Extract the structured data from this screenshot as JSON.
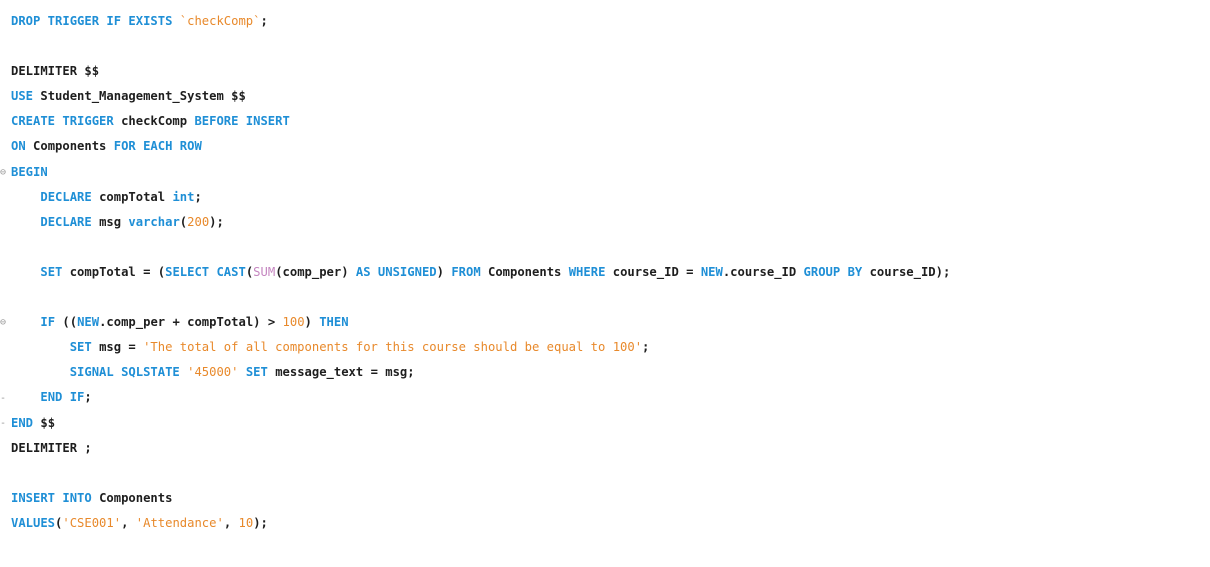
{
  "colors": {
    "keyword": "#1f8fd6",
    "string": "#e8892b",
    "number": "#e8892b",
    "function": "#c586c0",
    "text": "#1e1e1e",
    "background": "#ffffff"
  },
  "gutter_marks": [
    {
      "line_index": 6,
      "glyph": "⊖"
    },
    {
      "line_index": 12,
      "glyph": "⊖"
    },
    {
      "line_index": 15,
      "glyph": "-"
    },
    {
      "line_index": 16,
      "glyph": "-"
    }
  ],
  "lines": [
    [
      {
        "t": "kw",
        "v": "DROP TRIGGER IF EXISTS "
      },
      {
        "t": "str",
        "v": "`checkComp`"
      },
      {
        "t": "plain",
        "v": ";"
      }
    ],
    [],
    [
      {
        "t": "plain",
        "v": "DELIMITER $$"
      }
    ],
    [
      {
        "t": "kw",
        "v": "USE "
      },
      {
        "t": "plain",
        "v": "Student_Management_System $$"
      }
    ],
    [
      {
        "t": "kw",
        "v": "CREATE TRIGGER "
      },
      {
        "t": "plain",
        "v": "checkComp "
      },
      {
        "t": "kw",
        "v": "BEFORE INSERT"
      }
    ],
    [
      {
        "t": "kw",
        "v": "ON "
      },
      {
        "t": "plain",
        "v": "Components "
      },
      {
        "t": "kw",
        "v": "FOR EACH ROW"
      }
    ],
    [
      {
        "t": "kw",
        "v": "BEGIN"
      }
    ],
    [
      {
        "t": "plain",
        "v": "    "
      },
      {
        "t": "kw",
        "v": "DECLARE "
      },
      {
        "t": "plain",
        "v": "compTotal "
      },
      {
        "t": "kw",
        "v": "int"
      },
      {
        "t": "plain",
        "v": ";"
      }
    ],
    [
      {
        "t": "plain",
        "v": "    "
      },
      {
        "t": "kw",
        "v": "DECLARE "
      },
      {
        "t": "plain",
        "v": "msg "
      },
      {
        "t": "kw",
        "v": "varchar"
      },
      {
        "t": "plain",
        "v": "("
      },
      {
        "t": "num",
        "v": "200"
      },
      {
        "t": "plain",
        "v": ");"
      }
    ],
    [],
    [
      {
        "t": "plain",
        "v": "    "
      },
      {
        "t": "kw",
        "v": "SET "
      },
      {
        "t": "plain",
        "v": "compTotal = ("
      },
      {
        "t": "kw",
        "v": "SELECT CAST"
      },
      {
        "t": "plain",
        "v": "("
      },
      {
        "t": "fn",
        "v": "SUM"
      },
      {
        "t": "plain",
        "v": "(comp_per) "
      },
      {
        "t": "kw",
        "v": "AS UNSIGNED"
      },
      {
        "t": "plain",
        "v": ") "
      },
      {
        "t": "kw",
        "v": "FROM "
      },
      {
        "t": "plain",
        "v": "Components "
      },
      {
        "t": "kw",
        "v": "WHERE "
      },
      {
        "t": "plain",
        "v": "course_ID = "
      },
      {
        "t": "kw",
        "v": "NEW"
      },
      {
        "t": "plain",
        "v": ".course_ID "
      },
      {
        "t": "kw",
        "v": "GROUP BY "
      },
      {
        "t": "plain",
        "v": "course_ID);"
      }
    ],
    [],
    [
      {
        "t": "plain",
        "v": "    "
      },
      {
        "t": "kw",
        "v": "IF "
      },
      {
        "t": "plain",
        "v": "(("
      },
      {
        "t": "kw",
        "v": "NEW"
      },
      {
        "t": "plain",
        "v": ".comp_per + compTotal) > "
      },
      {
        "t": "num",
        "v": "100"
      },
      {
        "t": "plain",
        "v": ") "
      },
      {
        "t": "kw",
        "v": "THEN"
      }
    ],
    [
      {
        "t": "plain",
        "v": "        "
      },
      {
        "t": "kw",
        "v": "SET "
      },
      {
        "t": "plain",
        "v": "msg = "
      },
      {
        "t": "str",
        "v": "'The total of all components for this course should be equal to 100'"
      },
      {
        "t": "plain",
        "v": ";"
      }
    ],
    [
      {
        "t": "plain",
        "v": "        "
      },
      {
        "t": "kw",
        "v": "SIGNAL SQLSTATE "
      },
      {
        "t": "str",
        "v": "'45000'"
      },
      {
        "t": "plain",
        "v": " "
      },
      {
        "t": "kw",
        "v": "SET "
      },
      {
        "t": "plain",
        "v": "message_text = msg;"
      }
    ],
    [
      {
        "t": "plain",
        "v": "    "
      },
      {
        "t": "kw",
        "v": "END IF"
      },
      {
        "t": "plain",
        "v": ";"
      }
    ],
    [
      {
        "t": "kw",
        "v": "END "
      },
      {
        "t": "plain",
        "v": "$$"
      }
    ],
    [
      {
        "t": "plain",
        "v": "DELIMITER ;"
      }
    ],
    [],
    [
      {
        "t": "kw",
        "v": "INSERT INTO "
      },
      {
        "t": "plain",
        "v": "Components"
      }
    ],
    [
      {
        "t": "kw",
        "v": "VALUES"
      },
      {
        "t": "plain",
        "v": "("
      },
      {
        "t": "str",
        "v": "'CSE001'"
      },
      {
        "t": "plain",
        "v": ", "
      },
      {
        "t": "str",
        "v": "'Attendance'"
      },
      {
        "t": "plain",
        "v": ", "
      },
      {
        "t": "num",
        "v": "10"
      },
      {
        "t": "plain",
        "v": ");"
      }
    ]
  ]
}
